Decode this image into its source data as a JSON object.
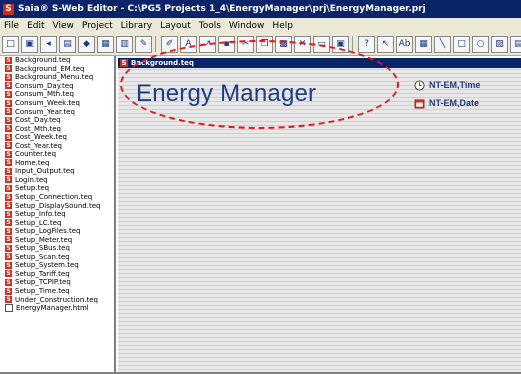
{
  "window": {
    "title": "Saia® S-Web Editor - C:\\PG5 Projects 1_4\\EnergyManager\\prj\\EnergyManager.prj"
  },
  "menu": [
    "File",
    "Edit",
    "View",
    "Project",
    "Library",
    "Layout",
    "Tools",
    "Window",
    "Help"
  ],
  "toolbar": {
    "buttons": [
      {
        "name": "new-icon",
        "glyph": "□"
      },
      {
        "name": "open-icon",
        "glyph": "▣"
      },
      {
        "name": "prev-icon",
        "glyph": "◂"
      },
      {
        "name": "pfd-icon",
        "glyph": "▤"
      },
      {
        "name": "bitmap-icon",
        "glyph": "◆"
      },
      {
        "name": "save-icon",
        "glyph": "▦"
      },
      {
        "name": "grid-icon",
        "glyph": "▥"
      },
      {
        "name": "pen-icon",
        "glyph": "✎"
      },
      {
        "name": "brush-icon",
        "glyph": "✐"
      },
      {
        "name": "font-icon",
        "glyph": "A"
      },
      {
        "name": "zoom-icon",
        "glyph": "↗"
      },
      {
        "name": "disk-icon",
        "glyph": "▪"
      },
      {
        "name": "cut-icon",
        "glyph": "✂"
      },
      {
        "name": "copy-icon",
        "glyph": "❐"
      },
      {
        "name": "paste-icon",
        "glyph": "▩"
      },
      {
        "name": "delete-icon",
        "glyph": "✕"
      },
      {
        "name": "print-icon",
        "glyph": "▭"
      },
      {
        "name": "printer-icon",
        "glyph": "▣"
      },
      {
        "name": "help-icon",
        "glyph": "?"
      },
      {
        "name": "pointer-icon",
        "glyph": "↖"
      },
      {
        "name": "text-icon",
        "glyph": "Ab"
      },
      {
        "name": "table-icon",
        "glyph": "▦"
      },
      {
        "name": "line-icon",
        "glyph": "╲"
      },
      {
        "name": "rect-icon",
        "glyph": "□"
      },
      {
        "name": "circle-icon",
        "glyph": "○"
      },
      {
        "name": "image-icon",
        "glyph": "▨"
      },
      {
        "name": "gauge-icon",
        "glyph": "▤"
      },
      {
        "name": "bar-icon",
        "glyph": "▥"
      },
      {
        "name": "button-icon",
        "glyph": "▭"
      },
      {
        "name": "slider-icon",
        "glyph": "┇"
      },
      {
        "name": "more-icon",
        "glyph": "▮"
      }
    ]
  },
  "files": [
    "Background.teq",
    "Background_EM.teq",
    "Background_Menu.teq",
    "Consum_Day.teq",
    "Consum_Mth.teq",
    "Consum_Week.teq",
    "Consum_Year.teq",
    "Cost_Day.teq",
    "Cost_Mth.teq",
    "Cost_Week.teq",
    "Cost_Year.teq",
    "Counter.teq",
    "Home.teq",
    "Input_Output.teq",
    "Login.teq",
    "Setup.teq",
    "Setup_Connection.teq",
    "Setup_DisplaySound.teq",
    "Setup_Info.teq",
    "Setup_LC.teq",
    "Setup_LogFiles.teq",
    "Setup_Meter.teq",
    "Setup_SBus.teq",
    "Setup_Scan.teq",
    "Setup_System.teq",
    "Setup_Tariff.teq",
    "Setup_TCPIP.teq",
    "Setup_Time.teq",
    "Under_Construction.teq",
    "EnergyManager.html"
  ],
  "document": {
    "tab_title": "Background.teq",
    "heading": "Energy Manager",
    "labels": [
      {
        "text": "NT-EM,Time",
        "icon": "clock-icon"
      },
      {
        "text": "NT-EM,Date",
        "icon": "calendar-icon"
      }
    ]
  },
  "annotation": {
    "color": "#e8141b"
  }
}
